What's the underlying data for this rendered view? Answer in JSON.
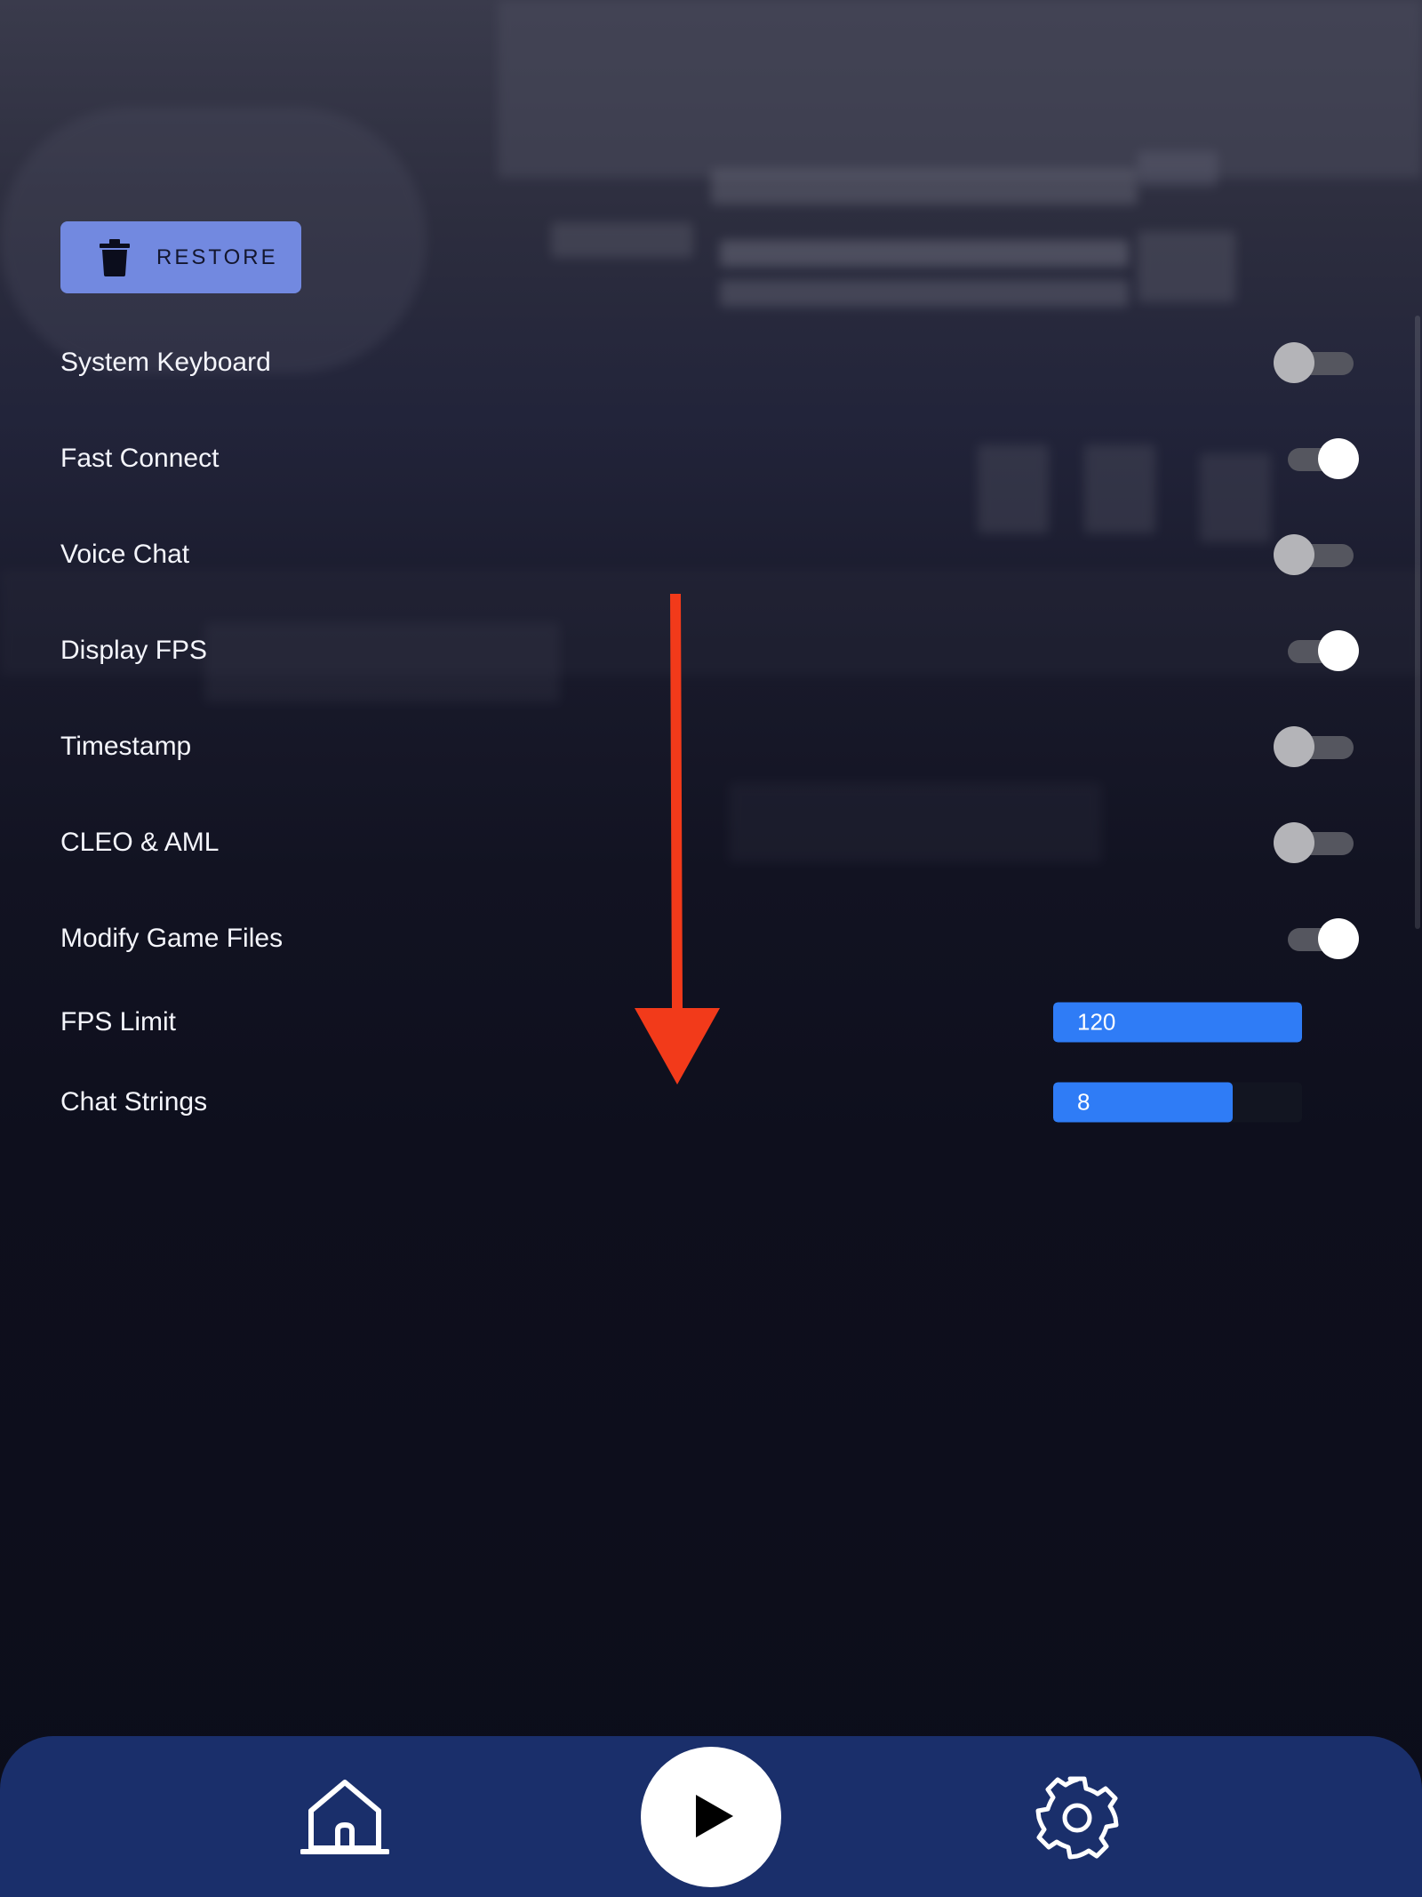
{
  "restore": {
    "label": "RESTORE",
    "icon": "trash-icon"
  },
  "settings": [
    {
      "label": "System Keyboard",
      "type": "toggle",
      "on": false
    },
    {
      "label": "Fast Connect",
      "type": "toggle",
      "on": true
    },
    {
      "label": "Voice Chat",
      "type": "toggle",
      "on": false
    },
    {
      "label": "Display FPS",
      "type": "toggle",
      "on": true
    },
    {
      "label": "Timestamp",
      "type": "toggle",
      "on": false
    },
    {
      "label": "CLEO & AML",
      "type": "toggle",
      "on": false
    },
    {
      "label": "Modify Game Files",
      "type": "toggle",
      "on": true
    }
  ],
  "sliders": [
    {
      "label": "FPS Limit",
      "value": "120",
      "fill_fraction": 1.0
    },
    {
      "label": "Chat Strings",
      "value": "8",
      "fill_fraction": 0.72
    }
  ],
  "annotation": {
    "icon": "down-arrow-icon",
    "color": "#f23a1a"
  },
  "bottom_nav": {
    "items": [
      {
        "icon": "home-icon"
      },
      {
        "icon": "play-icon"
      },
      {
        "icon": "gear-icon"
      }
    ]
  },
  "colors": {
    "accent": "#2f7cf6",
    "restore_button": "#7289e0",
    "nav_bar": "#1a2f6b"
  }
}
